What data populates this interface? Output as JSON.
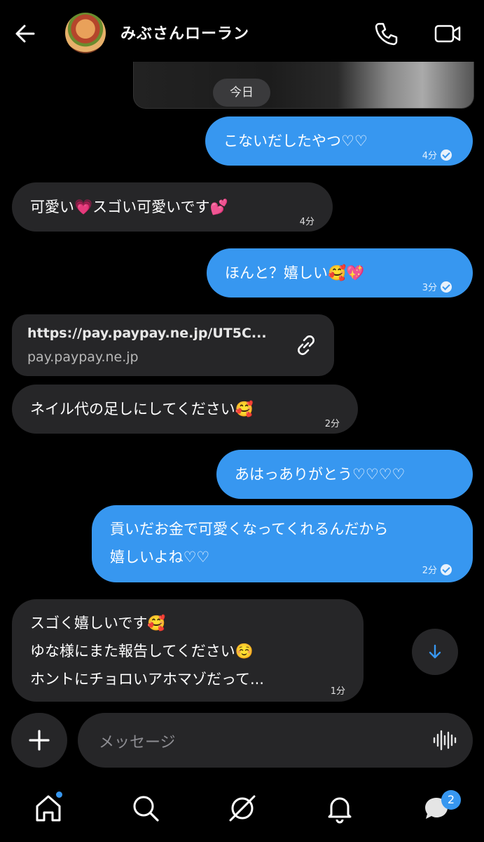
{
  "header": {
    "title": "みぶさんローラン"
  },
  "date_label": "今日",
  "messages": [
    {
      "dir": "out",
      "text": "こないだしたやつ♡♡",
      "time": "4分"
    },
    {
      "dir": "in",
      "text": "可愛い💗スゴい可愛いです💕",
      "time": "4分"
    },
    {
      "dir": "out",
      "text": "ほんと？嬉しい🥰💖",
      "time": "3分"
    },
    {
      "dir": "in",
      "link_url": "https://pay.paypay.ne.jp/UT5C...",
      "link_host": "pay.paypay.ne.jp"
    },
    {
      "dir": "in",
      "text": "ネイル代の足しにしてください🥰",
      "time": "2分"
    },
    {
      "dir": "out",
      "text": "あはっありがとう♡♡♡♡"
    },
    {
      "dir": "out",
      "line1": "貢いだお金で可愛くなってくれるんだから",
      "line2": "嬉しいよね♡♡",
      "time": "2分"
    },
    {
      "dir": "in",
      "line1": "スゴく嬉しいです🥰",
      "line2": "ゆな様にまた報告してください☺️",
      "line3": "ホントにチョロいアホマゾだって...",
      "time": "1分"
    }
  ],
  "composer": {
    "placeholder": "メッセージ"
  },
  "nav": {
    "messages_badge": "2"
  },
  "colors": {
    "outgoing": "#3797f0",
    "incoming": "#262628",
    "background": "#000000"
  }
}
